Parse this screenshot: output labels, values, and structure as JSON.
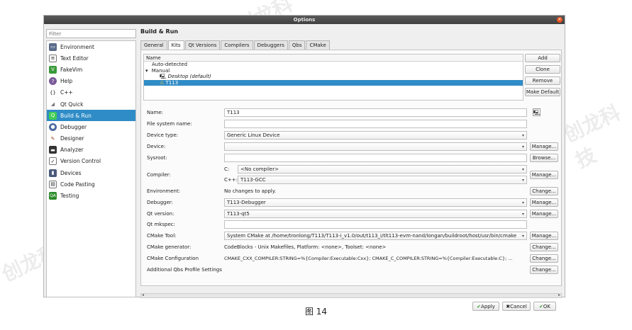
{
  "window": {
    "title": "Options"
  },
  "filter": {
    "placeholder": "Filter"
  },
  "sidebar": {
    "items": [
      {
        "label": "Environment",
        "icon": "monitor-icon"
      },
      {
        "label": "Text Editor",
        "icon": "text-editor-icon"
      },
      {
        "label": "FakeVim",
        "icon": "fakevim-icon"
      },
      {
        "label": "Help",
        "icon": "help-icon"
      },
      {
        "label": "C++",
        "icon": "cpp-icon"
      },
      {
        "label": "Qt Quick",
        "icon": "qtquick-icon"
      },
      {
        "label": "Build & Run",
        "icon": "build-run-icon",
        "selected": true
      },
      {
        "label": "Debugger",
        "icon": "debugger-icon"
      },
      {
        "label": "Designer",
        "icon": "designer-icon"
      },
      {
        "label": "Analyzer",
        "icon": "analyzer-icon"
      },
      {
        "label": "Version Control",
        "icon": "version-control-icon"
      },
      {
        "label": "Devices",
        "icon": "devices-icon"
      },
      {
        "label": "Code Pasting",
        "icon": "code-pasting-icon"
      },
      {
        "label": "Testing",
        "icon": "testing-icon"
      }
    ]
  },
  "main": {
    "title": "Build & Run",
    "tabs": [
      "General",
      "Kits",
      "Qt Versions",
      "Compilers",
      "Debuggers",
      "Qbs",
      "CMake"
    ],
    "active_tab": "Kits"
  },
  "kits": {
    "header": "Name",
    "tree": [
      "Auto-detected",
      "Manual",
      "Desktop (default)",
      "T113"
    ],
    "buttons": {
      "add": "Add",
      "clone": "Clone",
      "remove": "Remove",
      "make_default": "Make Default"
    }
  },
  "form": {
    "name": {
      "label": "Name:",
      "value": "T113"
    },
    "fs_name": {
      "label": "File system name:",
      "value": ""
    },
    "device_type": {
      "label": "Device type:",
      "value": "Generic Linux Device"
    },
    "device": {
      "label": "Device:",
      "value": "",
      "button": "Manage..."
    },
    "sysroot": {
      "label": "Sysroot:",
      "value": "",
      "button": "Browse..."
    },
    "compiler": {
      "label": "Compiler:",
      "c_label": "C:",
      "c_value": "<No compiler>",
      "cpp_label": "C++:",
      "cpp_value": "T113-GCC",
      "button": "Manage..."
    },
    "environment": {
      "label": "Environment:",
      "value": "No changes to apply.",
      "button": "Change..."
    },
    "debugger": {
      "label": "Debugger:",
      "value": "T113-Debugger",
      "button": "Manage..."
    },
    "qt_version": {
      "label": "Qt version:",
      "value": "T113-qt5",
      "button": "Manage..."
    },
    "qt_mkspec": {
      "label": "Qt mkspec:",
      "value": ""
    },
    "cmake_tool": {
      "label": "CMake Tool:",
      "value": "System CMake at /home/tronlong/T113/T113-i_v1.0/out/t113_i/tlt113-evm-nand/longan/buildroot/host/usr/bin/cmake",
      "button": "Manage..."
    },
    "cmake_generator": {
      "label": "CMake generator:",
      "value": "CodeBlocks - Unix Makefiles, Platform: <none>, Toolset: <none>",
      "button": "Change..."
    },
    "cmake_config": {
      "label": "CMake Configuration",
      "value": "CMAKE_CXX_COMPILER:STRING=%{Compiler:Executable:Cxx}; CMAKE_C_COMPILER:STRING=%{Compiler:Executable:C}; ...",
      "button": "Change..."
    },
    "qbs_profile": {
      "label": "Additional Qbs Profile Settings",
      "button": "Change..."
    }
  },
  "footer": {
    "apply": "Apply",
    "cancel": "Cancel",
    "ok": "OK"
  },
  "caption": "图 14",
  "colors": {
    "selection": "#308cc6",
    "titlebar": "#4a4a4a",
    "close": "#e9541f"
  }
}
